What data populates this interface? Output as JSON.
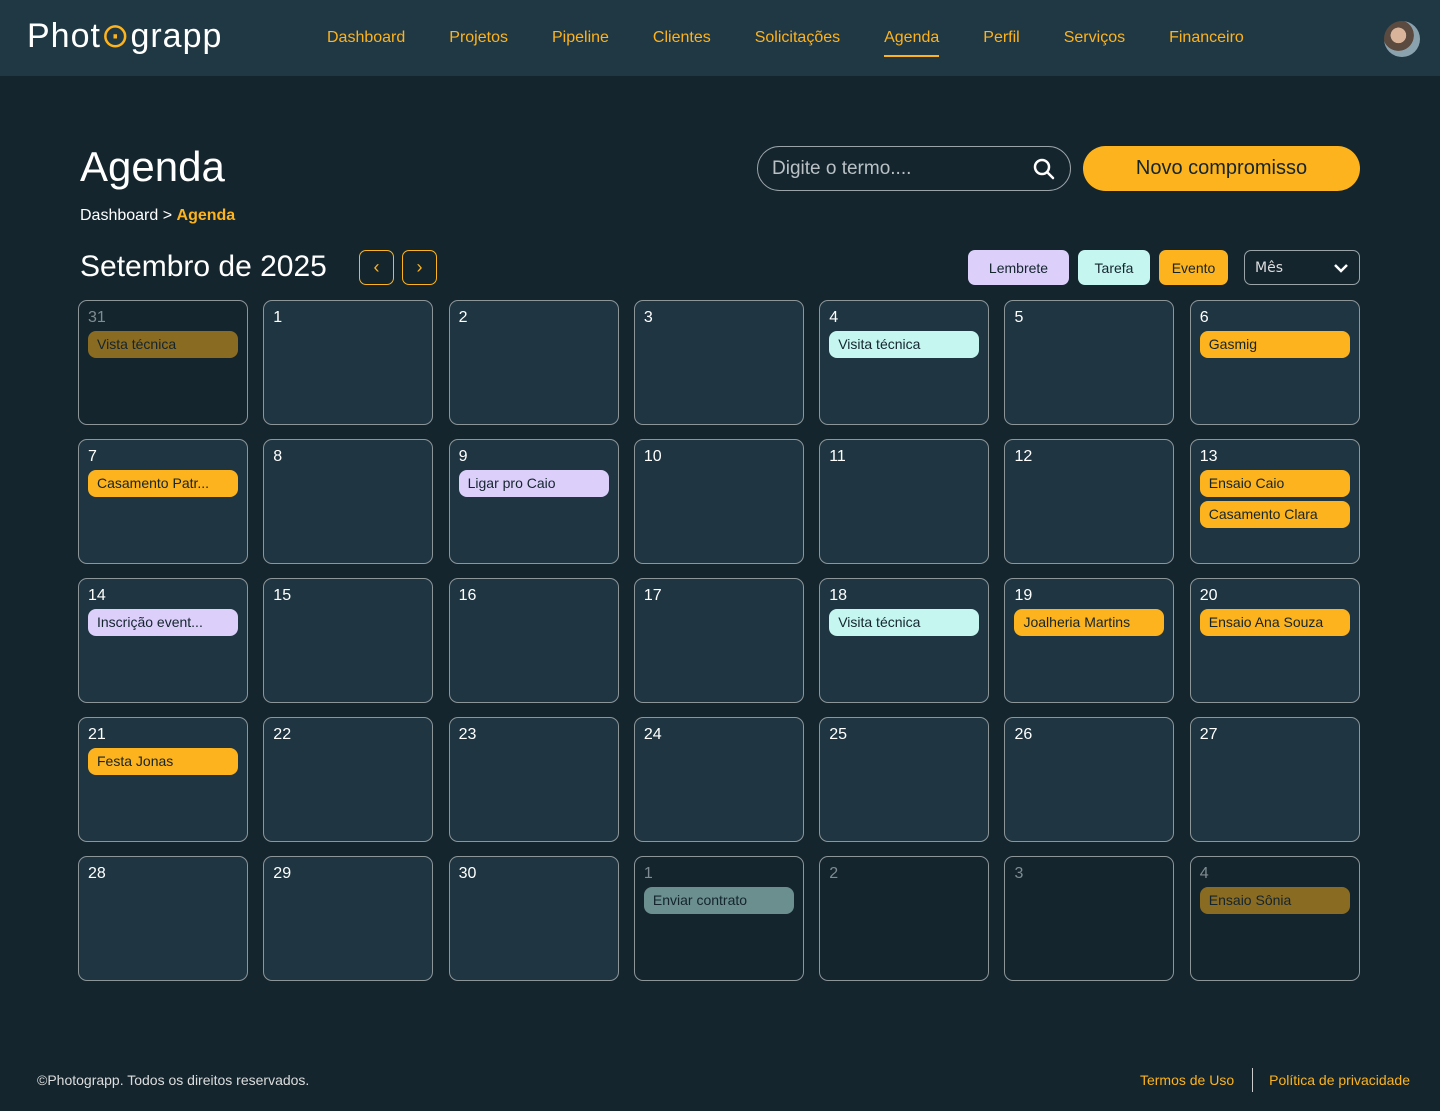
{
  "header": {
    "logo": "Photograpp",
    "nav": [
      "Dashboard",
      "Projetos",
      "Pipeline",
      "Clientes",
      "Solicitações",
      "Agenda",
      "Perfil",
      "Serviços",
      "Financeiro"
    ],
    "active": "Agenda"
  },
  "page": {
    "title": "Agenda",
    "breadcrumb": {
      "parent": "Dashboard",
      "separator": ">",
      "current": "Agenda"
    }
  },
  "search": {
    "placeholder": "Digite o termo...."
  },
  "new_button": "Novo compromisso",
  "calendar": {
    "month_label": "Setembro de 2025",
    "filters": {
      "reminder": "Lembrete",
      "task": "Tarefa",
      "event": "Evento"
    },
    "view": "Mês",
    "days": [
      {
        "n": "31",
        "out": true,
        "ev": [
          {
            "l": "Vista técnica",
            "t": "event"
          }
        ]
      },
      {
        "n": "1",
        "ev": []
      },
      {
        "n": "2",
        "ev": []
      },
      {
        "n": "3",
        "ev": []
      },
      {
        "n": "4",
        "ev": [
          {
            "l": "Visita técnica",
            "t": "task"
          }
        ]
      },
      {
        "n": "5",
        "ev": []
      },
      {
        "n": "6",
        "ev": [
          {
            "l": "Gasmig",
            "t": "event"
          }
        ]
      },
      {
        "n": "7",
        "ev": [
          {
            "l": "Casamento Patr...",
            "t": "event"
          }
        ]
      },
      {
        "n": "8",
        "ev": []
      },
      {
        "n": "9",
        "ev": [
          {
            "l": "Ligar pro Caio",
            "t": "reminder"
          }
        ]
      },
      {
        "n": "10",
        "ev": []
      },
      {
        "n": "11",
        "ev": []
      },
      {
        "n": "12",
        "ev": []
      },
      {
        "n": "13",
        "ev": [
          {
            "l": "Ensaio Caio",
            "t": "event"
          },
          {
            "l": "Casamento Clara",
            "t": "event"
          }
        ]
      },
      {
        "n": "14",
        "ev": [
          {
            "l": "Inscrição event...",
            "t": "reminder"
          }
        ]
      },
      {
        "n": "15",
        "ev": []
      },
      {
        "n": "16",
        "ev": []
      },
      {
        "n": "17",
        "ev": []
      },
      {
        "n": "18",
        "ev": [
          {
            "l": "Visita técnica",
            "t": "task"
          }
        ]
      },
      {
        "n": "19",
        "ev": [
          {
            "l": "Joalheria Martins",
            "t": "event"
          }
        ]
      },
      {
        "n": "20",
        "ev": [
          {
            "l": "Ensaio Ana Souza",
            "t": "event"
          }
        ]
      },
      {
        "n": "21",
        "ev": [
          {
            "l": "Festa Jonas",
            "t": "event"
          }
        ]
      },
      {
        "n": "22",
        "ev": []
      },
      {
        "n": "23",
        "ev": []
      },
      {
        "n": "24",
        "ev": []
      },
      {
        "n": "25",
        "ev": []
      },
      {
        "n": "26",
        "ev": []
      },
      {
        "n": "27",
        "ev": []
      },
      {
        "n": "28",
        "ev": []
      },
      {
        "n": "29",
        "ev": []
      },
      {
        "n": "30",
        "ev": []
      },
      {
        "n": "1",
        "out": true,
        "ev": [
          {
            "l": "Enviar contrato",
            "t": "task"
          }
        ]
      },
      {
        "n": "2",
        "out": true,
        "ev": []
      },
      {
        "n": "3",
        "out": true,
        "ev": []
      },
      {
        "n": "4",
        "out": true,
        "ev": [
          {
            "l": "Ensaio Sônia",
            "t": "event"
          }
        ]
      }
    ]
  },
  "footer": {
    "copyright": "©Photograpp. Todos os direitos reservados.",
    "terms": "Termos de Uso",
    "privacy": "Política de privacidade"
  }
}
